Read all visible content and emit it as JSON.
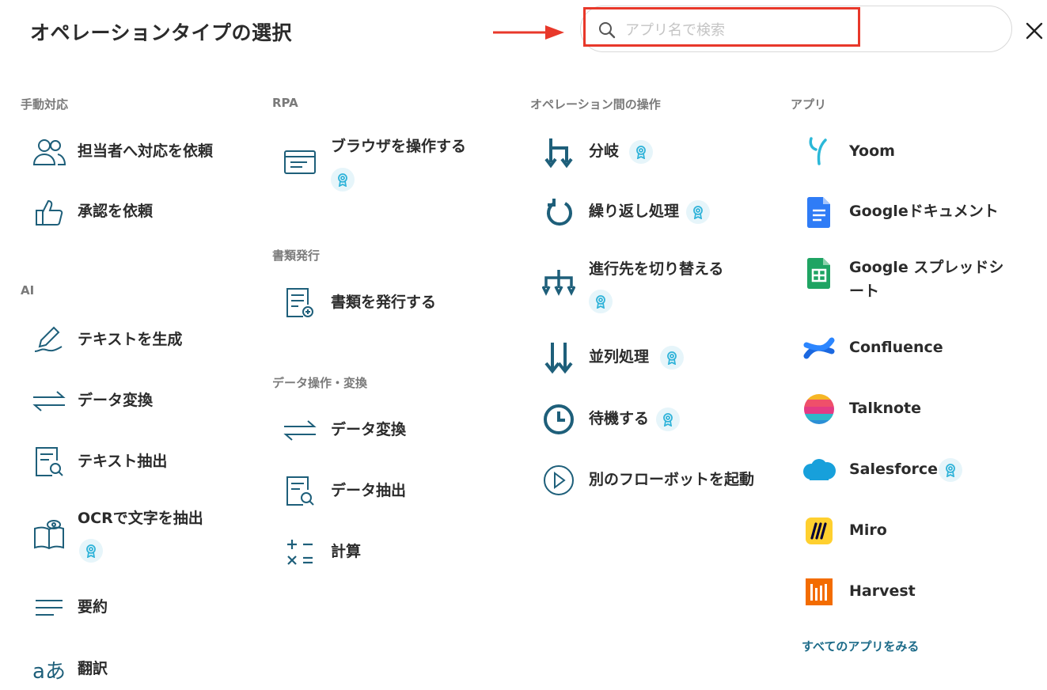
{
  "header": {
    "title": "オペレーションタイプの選択",
    "search_placeholder": "アプリ名で検索"
  },
  "sections": {
    "manual": "手動対応",
    "ai": "AI",
    "rpa": "RPA",
    "docs": "書類発行",
    "data_ops": "データ操作・変換",
    "between_ops": "オペレーション間の操作",
    "apps": "アプリ"
  },
  "items": {
    "request_assignee": "担当者へ対応を依頼",
    "request_approval": "承認を依頼",
    "generate_text": "テキストを生成",
    "ai_data_convert": "データ変換",
    "extract_text": "テキスト抽出",
    "ocr_extract": "OCRで文字を抽出",
    "summarize": "要約",
    "translate": "翻訳",
    "browser_operate": "ブラウザを操作する",
    "issue_document": "書類を発行する",
    "data_convert": "データ変換",
    "data_extract": "データ抽出",
    "calculate": "計算",
    "branch": "分岐",
    "loop": "繰り返し処理",
    "switch_route": "進行先を切り替える",
    "parallel": "並列処理",
    "wait": "待機する",
    "start_flowbot": "別のフローボットを起動"
  },
  "apps": {
    "yoom": "Yoom",
    "google_docs": "Googleドキュメント",
    "google_sheets": "Google スプレッドシート",
    "confluence": "Confluence",
    "talknote": "Talknote",
    "salesforce": "Salesforce",
    "miro": "Miro",
    "harvest": "Harvest",
    "see_all": "すべてのアプリをみる"
  },
  "colors": {
    "icon": "#1e5f7a",
    "accent": "#1b6a88",
    "highlight": "#e8382a",
    "badge_bg": "#e6f5fa",
    "badge_fg": "#2fb3d9"
  }
}
